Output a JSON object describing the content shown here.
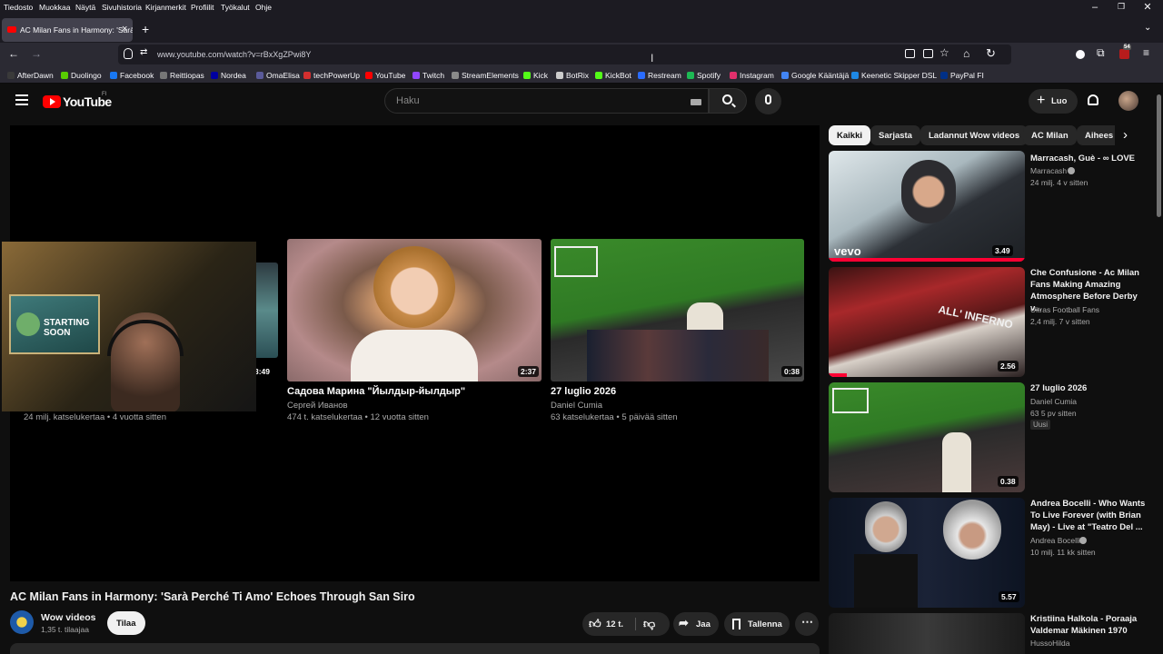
{
  "menu": [
    "Tiedosto",
    "Muokkaa",
    "Näytä",
    "Sivuhistoria",
    "Kirjanmerkit",
    "Profiilit",
    "Työkalut",
    "Ohje"
  ],
  "tab": {
    "title": "AC Milan Fans in Harmony: 'Sarà",
    "close": "×"
  },
  "new_tab": "+",
  "url": "www.youtube.com/watch?v=rBxXgZPwi8Y",
  "extension_badge": "54",
  "bookmarks": [
    {
      "label": "AfterDawn",
      "color": "#3a3a3a"
    },
    {
      "label": "Duolingo",
      "color": "#58cc02"
    },
    {
      "label": "Facebook",
      "color": "#1877f2"
    },
    {
      "label": "Reittiopas",
      "color": "#777777"
    },
    {
      "label": "Nordea",
      "color": "#0000a0"
    },
    {
      "label": "OmaElisa",
      "color": "#5a5a9a"
    },
    {
      "label": "techPowerUp",
      "color": "#d32f2f"
    },
    {
      "label": "YouTube",
      "color": "#ff0000"
    },
    {
      "label": "Twitch",
      "color": "#9146ff"
    },
    {
      "label": "StreamElements",
      "color": "#8a8a8a"
    },
    {
      "label": "Kick",
      "color": "#53fc18"
    },
    {
      "label": "BotRix",
      "color": "#cccccc"
    },
    {
      "label": "KickBot",
      "color": "#53fc18"
    },
    {
      "label": "Restream",
      "color": "#2a6cff"
    },
    {
      "label": "Spotify",
      "color": "#1db954"
    },
    {
      "label": "Instagram",
      "color": "#e1306c"
    },
    {
      "label": "Google Kääntäjä",
      "color": "#4285f4"
    },
    {
      "label": "Keenetic Skipper DSL",
      "color": "#1e88e5"
    },
    {
      "label": "PayPal FI",
      "color": "#003087"
    }
  ],
  "youtube": {
    "logo": "YouTube",
    "region": "FI",
    "search_placeholder": "Haku",
    "create_label": "Luo",
    "chips": [
      "Kaikki",
      "Sarjasta",
      "Ladannut Wow videos",
      "AC Milan",
      "Aihees"
    ],
    "end_cards": [
      {
        "duration": "3:49",
        "title": "",
        "channel": "",
        "meta": "24 milj. katselukertaa • 4 vuotta sitten"
      },
      {
        "duration": "2:37",
        "title": "Садова Марина \"Йылдыр-йылдыр\"",
        "channel": "Сергей Иванов",
        "meta": "474 t. katselukertaa • 12 vuotta sitten"
      },
      {
        "duration": "0:38",
        "title": "27 luglio 2026",
        "channel": "Daniel Cumia",
        "meta": "63 katselukertaa • 5 päivää sitten"
      }
    ],
    "webcam_sign": "STARTING SOON",
    "video_title": "AC Milan Fans in Harmony: 'Sarà Perché Ti Amo' Echoes Through San Siro",
    "channel_name": "Wow videos",
    "subscribers": "1,35 t. tilaajaa",
    "subscribe_label": "Tilaa",
    "likes": "12 t.",
    "share_label": "Jaa",
    "save_label": "Tallenna",
    "recommendations": [
      {
        "title": "Marracash, Guè - ∞ LOVE",
        "channel": "Marracash",
        "verified": true,
        "stats": "24 milj.   4 v sitten",
        "duration": "3.49",
        "badge": "",
        "thumb_text": "vevo"
      },
      {
        "title": "Che Confusione - Ac Milan Fans Making Amazing Atmosphere Before Derby v...",
        "channel": "Ultras Football Fans",
        "verified": false,
        "stats": "2,4 milj.   7 v sitten",
        "duration": "2.56",
        "badge": "",
        "thumb_text": "ALL' INFERNO"
      },
      {
        "title": "27 luglio 2026",
        "channel": "Daniel Cumia",
        "verified": false,
        "stats": "63   5 pv sitten",
        "duration": "0.38",
        "badge": "Uusi",
        "thumb_text": ""
      },
      {
        "title": "Andrea Bocelli - Who Wants To Live Forever (with Brian May) - Live at \"Teatro Del ...",
        "channel": "Andrea Bocelli",
        "verified": true,
        "stats": "10 milj.   11 kk sitten",
        "duration": "5.57",
        "badge": "",
        "thumb_text": ""
      },
      {
        "title": "Kristiina Halkola - Poraaja Valdemar Mäkinen 1970",
        "channel": "HussoHilda",
        "verified": false,
        "stats": "",
        "duration": "",
        "badge": "",
        "thumb_text": ""
      }
    ]
  }
}
